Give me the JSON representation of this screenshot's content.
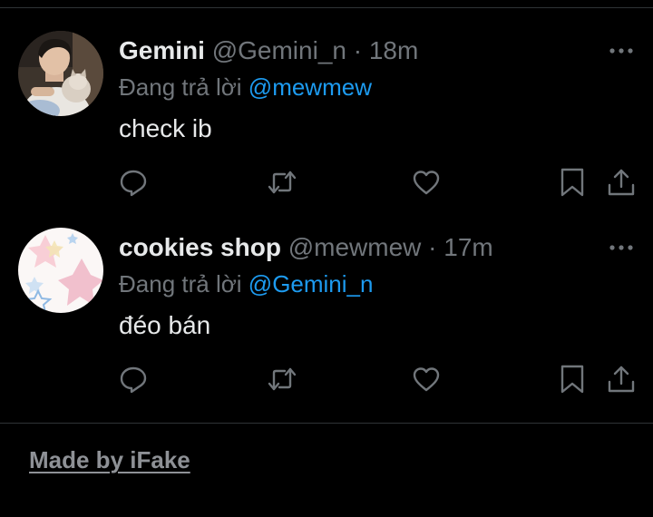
{
  "tweets": [
    {
      "display_name": "Gemini",
      "handle": "@Gemini_n",
      "separator": "·",
      "time": "18m",
      "replying_prefix": "Đang trả lời",
      "replying_to": "@mewmew",
      "text": "check ib",
      "avatar_icon": "user-photo-with-cat"
    },
    {
      "display_name": "cookies shop",
      "handle": "@mewmew",
      "separator": "·",
      "time": "17m",
      "replying_prefix": "Đang trả lời",
      "replying_to": "@Gemini_n",
      "text": "đéo bán",
      "avatar_icon": "pastel-stars-avatar"
    }
  ],
  "actions": [
    "reply-icon",
    "retweet-icon",
    "like-icon",
    "bookmark-icon",
    "share-icon"
  ],
  "watermark": "Made by iFake",
  "colors": {
    "background": "#000000",
    "text": "#e7e9ea",
    "muted": "#71767b",
    "link": "#1d9bf0",
    "divider": "#2f3336"
  }
}
